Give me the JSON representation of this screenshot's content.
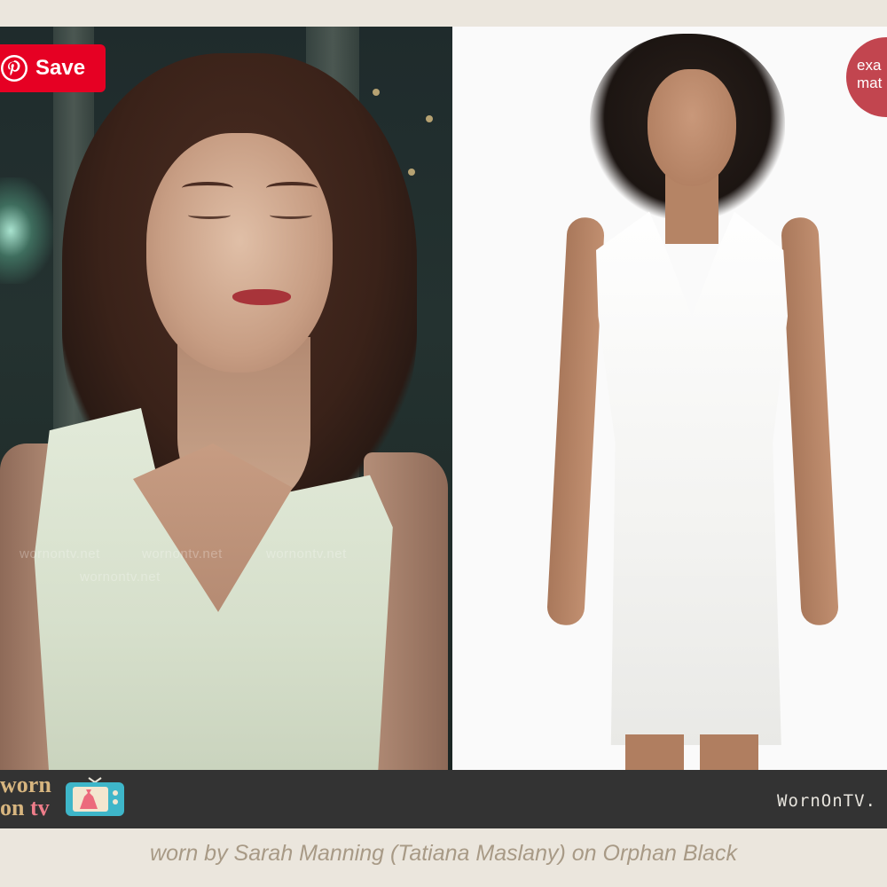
{
  "pin_button": {
    "label": "Save",
    "icon": "pinterest-icon",
    "color": "#e60023"
  },
  "left_image": {
    "watermark_lines": [
      "wornontv.net",
      "wornontv.net",
      "wornontv.net",
      "wornontv.net"
    ]
  },
  "right_image": {
    "badge_line1": "exa",
    "badge_line2": "mat",
    "badge_color": "#c2454f"
  },
  "brand_bar": {
    "logo_line1": "worn",
    "logo_line2_a": "on",
    "logo_line2_b": "tv",
    "logo_icon": "tv-dress-icon",
    "url": "WornOnTV.",
    "background": "#333333"
  },
  "caption": "worn by Sarah Manning (Tatiana Maslany) on Orphan Black"
}
